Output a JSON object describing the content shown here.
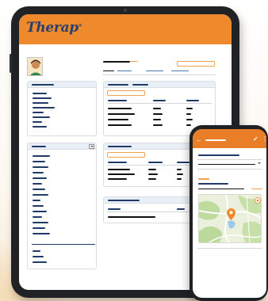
{
  "app": {
    "logo_text": "Therap",
    "logo_mark": "®"
  },
  "phone": {
    "back_icon": "←",
    "confirm_icon": "✓",
    "menu_icon": "⋮"
  },
  "colors": {
    "brand_orange": "#ef8a2c",
    "navy": "#1f3a66",
    "link_blue": "#4a78b5"
  },
  "icons": [
    "back-arrow-icon",
    "check-icon",
    "kebab-menu-icon",
    "chevron-down-icon",
    "map-pin-icon",
    "location-target-icon"
  ]
}
